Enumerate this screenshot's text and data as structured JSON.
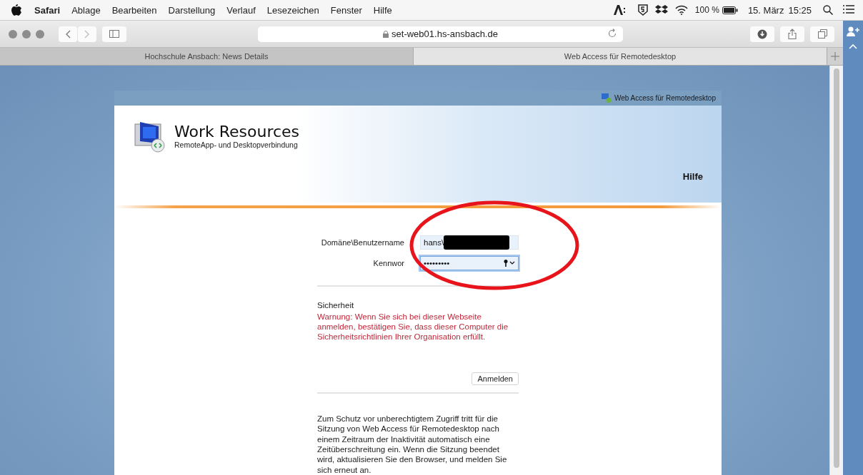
{
  "menu_bar": {
    "app": "Safari",
    "items": [
      "Ablage",
      "Bearbeiten",
      "Darstellung",
      "Verlauf",
      "Lesezeichen",
      "Fenster",
      "Hilfe"
    ],
    "battery": "100 %",
    "date": "15. März",
    "time": "15:25"
  },
  "toolbar": {
    "url": "set-web01.hs-ansbach.de"
  },
  "tabs": [
    {
      "label": "Hochschule Ansbach: News Details",
      "selected": false
    },
    {
      "label": "Web Access für Remotedesktop",
      "selected": true
    }
  ],
  "page": {
    "header_link": "Web Access für Remotedesktop",
    "title": "Work Resources",
    "subtitle": "RemoteApp- und Desktopverbindung",
    "help": "Hilfe",
    "fields": [
      {
        "label": "Domäne\\Benutzername",
        "value": "hans\\",
        "redacted": true,
        "focused": false
      },
      {
        "label": "Kennwor",
        "value": "•••••••••",
        "redacted": false,
        "focused": true
      }
    ],
    "security_heading": "Sicherheit",
    "warning": "Warnung: Wenn Sie sich bei dieser Webseite anmelden, bestätigen Sie, dass dieser Computer die Sicherheitsrichtlinien Ihrer Organisation erfüllt.",
    "submit": "Anmelden",
    "timeout_note": "Zum Schutz vor unberechtigtem Zugriff tritt für die Sitzung von Web Access für Remotedesktop nach einem Zeitraum der Inaktivität automatisch eine Zeitüberschreitung ein. Wenn die Sitzung beendet wird, aktualisieren Sie den Browser, und melden Sie sich erneut an."
  },
  "annotation": {
    "kind": "ellipse",
    "color": "#e8141b"
  }
}
